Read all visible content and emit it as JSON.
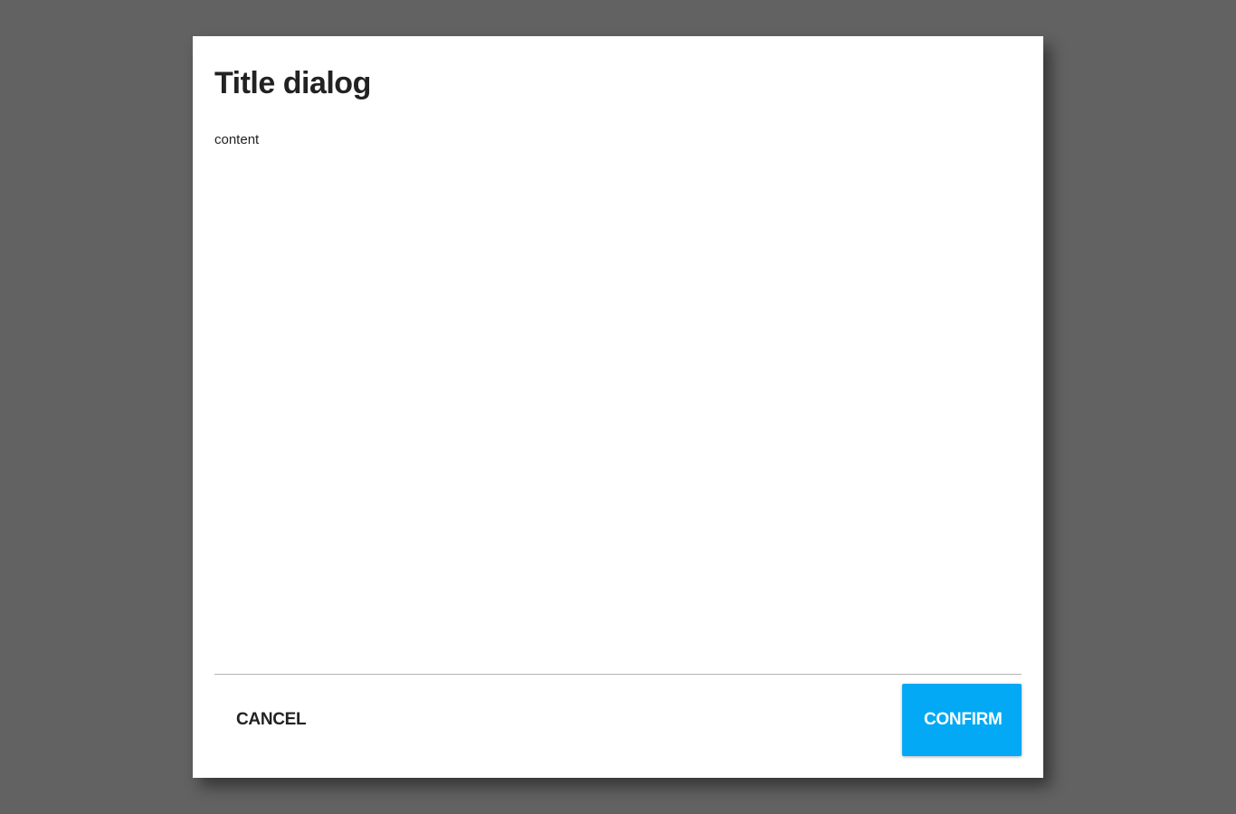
{
  "dialog": {
    "title": "Title dialog",
    "content": "content",
    "cancel_label": "CANCEL",
    "confirm_label": "CONFIRM"
  },
  "colors": {
    "backdrop": "#626262",
    "surface": "#ffffff",
    "accent": "#03a9f4",
    "text": "#222222",
    "divider": "#b3b3b3"
  }
}
